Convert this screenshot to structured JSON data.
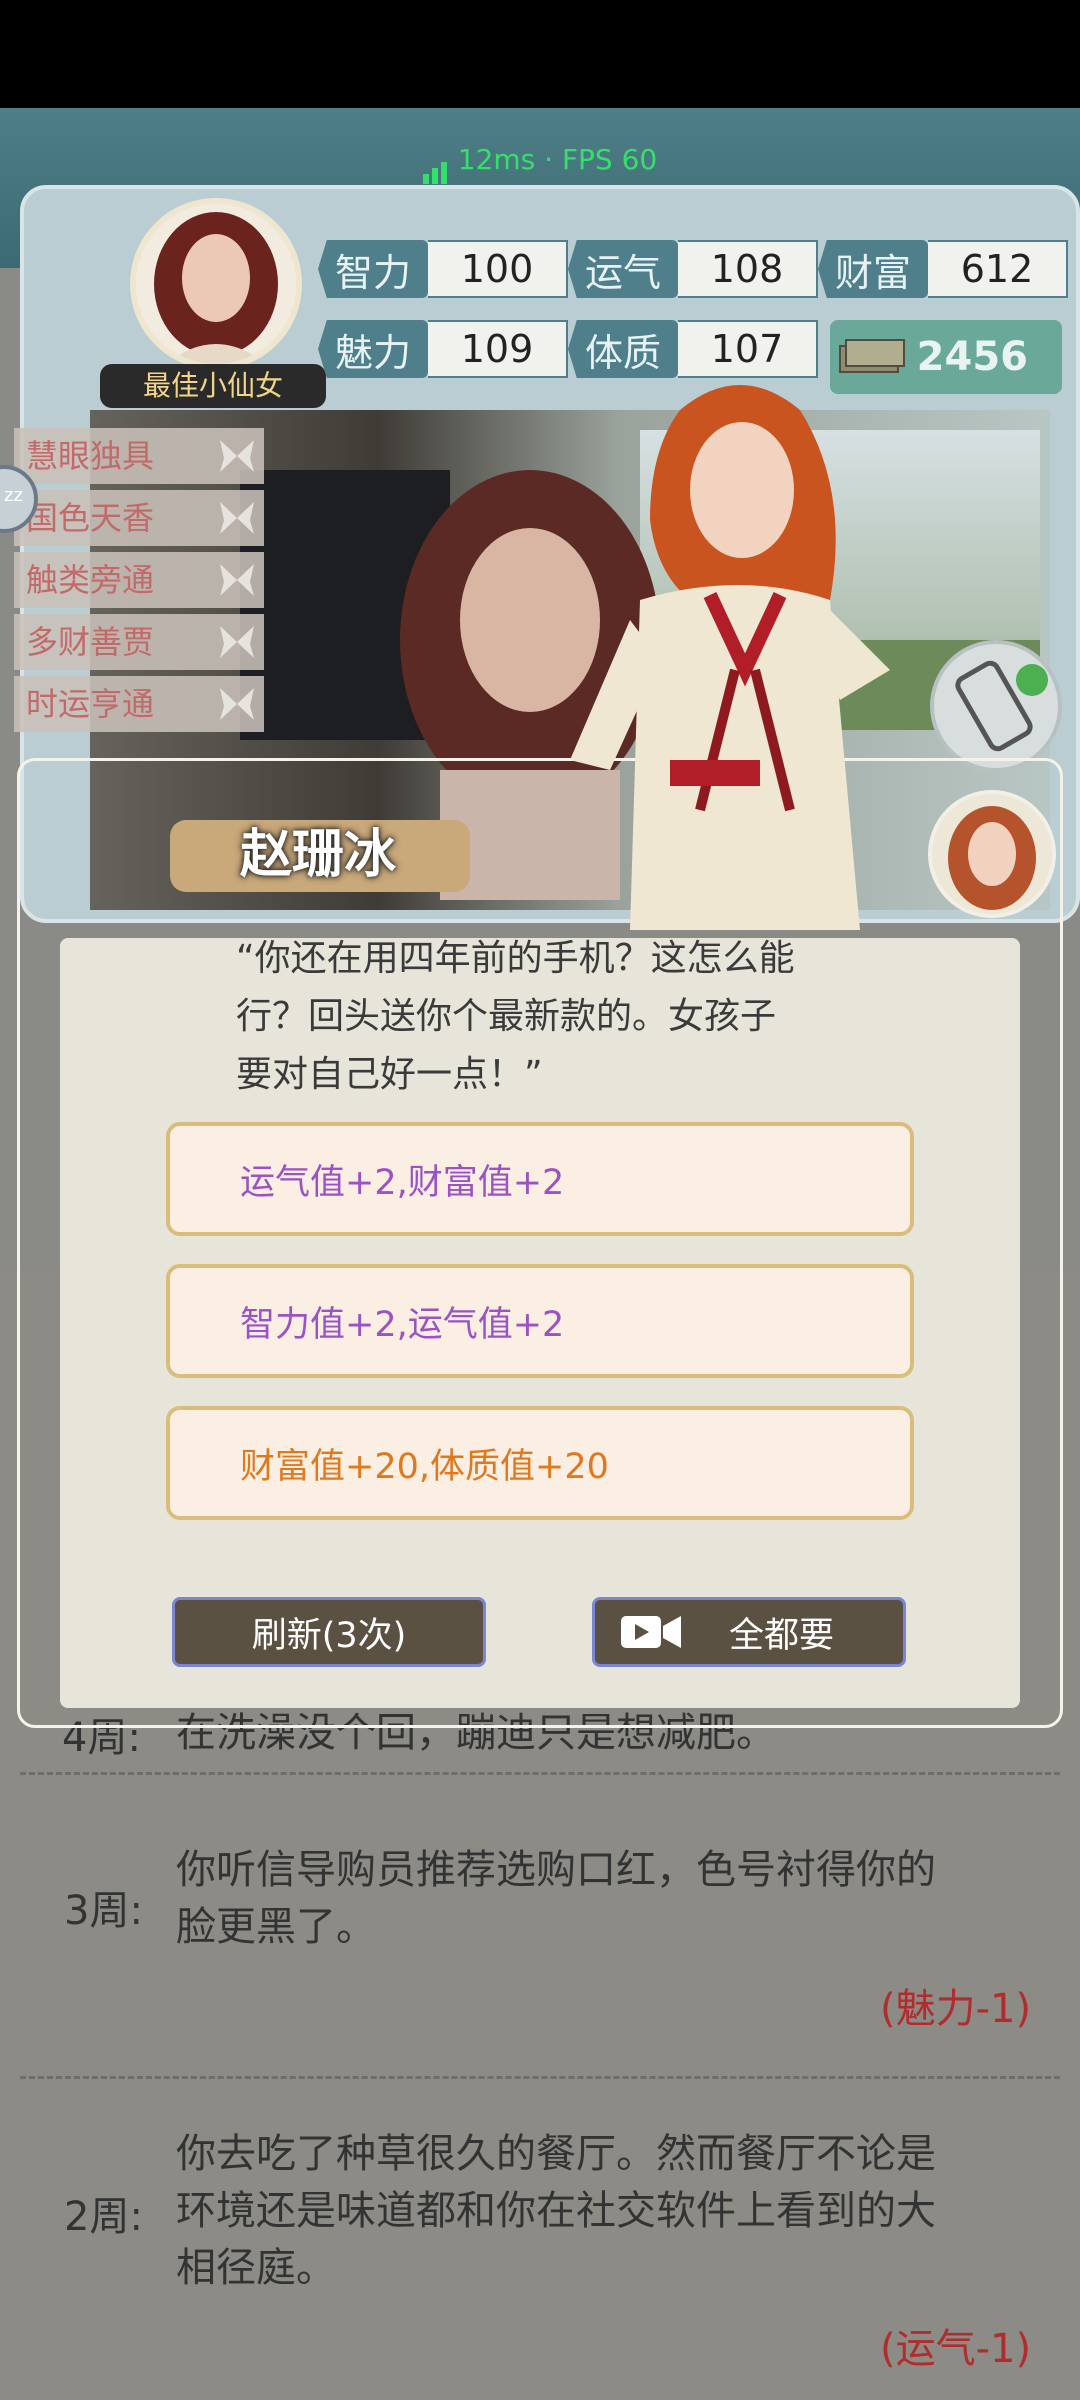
{
  "perf": {
    "text": "12ms · FPS 60"
  },
  "profile": {
    "title": "最佳小仙女",
    "stats": [
      {
        "label": "智力",
        "value": "100"
      },
      {
        "label": "运气",
        "value": "108"
      },
      {
        "label": "财富",
        "value": "612"
      },
      {
        "label": "魅力",
        "value": "109"
      },
      {
        "label": "体质",
        "value": "107"
      }
    ],
    "money": "2456"
  },
  "traits": [
    "慧眼独具",
    "国色天香",
    "触类旁通",
    "多财善贾",
    "时运亨通"
  ],
  "side_left_label": "zz",
  "modal": {
    "name": "赵珊冰",
    "quote_lines": [
      "“你还在用四年前的手机？这怎么能",
      "行？回头送你个最新款的。女孩子",
      "要对自己好一点！”"
    ],
    "options": [
      {
        "text": "运气值+2,财富值+2",
        "color": "#9a52c4"
      },
      {
        "text": "智力值+2,运气值+2",
        "color": "#9a52c4"
      },
      {
        "text": "财富值+20,体质值+20",
        "color": "#e0781e"
      }
    ],
    "refresh_label": "刷新(3次)",
    "take_all_label": "全都要"
  },
  "diary": {
    "entries": [
      {
        "week": "4周:",
        "text_lines": [
          "在洗澡没个回，蹦迪只是想减肥。"
        ],
        "effect": ""
      },
      {
        "week": "3周:",
        "text_lines": [
          "你听信导购员推荐选购口红，色号衬得你的",
          "脸更黑了。"
        ],
        "effect": "(魅力-1)"
      },
      {
        "week": "2周:",
        "text_lines": [
          "你去吃了种草很久的餐厅。然而餐厅不论是",
          "环境还是味道都和你在社交软件上看到的大",
          "相径庭。"
        ],
        "effect": "(运气-1)"
      }
    ]
  }
}
